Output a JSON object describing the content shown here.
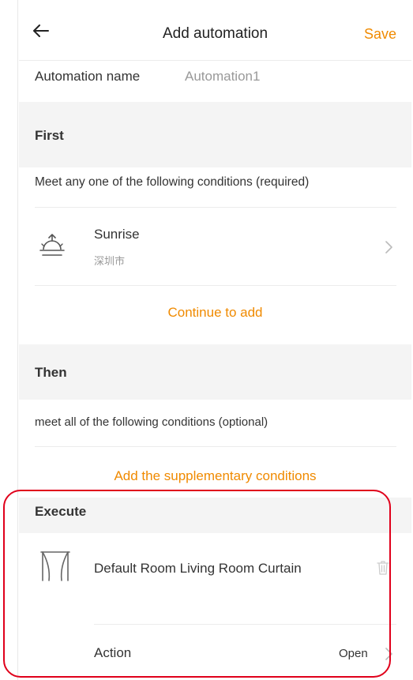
{
  "header": {
    "title": "Add automation",
    "save_label": "Save",
    "back_icon": "back-arrow-icon"
  },
  "automation": {
    "name_label": "Automation name",
    "name_value": "Automation1"
  },
  "first": {
    "heading": "First",
    "condition_text": "Meet any one of the following conditions (required)",
    "conditions": [
      {
        "title": "Sunrise",
        "subtitle": "深圳市",
        "icon": "sunrise-icon"
      }
    ],
    "continue_label": "Continue to add"
  },
  "then": {
    "heading": "Then",
    "condition_text": "meet all of the following conditions (optional)",
    "add_label": "Add the supplementary conditions"
  },
  "execute": {
    "heading": "Execute",
    "devices": [
      {
        "name": "Default Room Living Room Curtain",
        "icon": "curtain-icon",
        "action_label": "Action",
        "action_value": "Open"
      }
    ]
  },
  "colors": {
    "accent": "#f08a00",
    "section_bg": "#f4f4f4",
    "highlight": "#e0001b"
  }
}
